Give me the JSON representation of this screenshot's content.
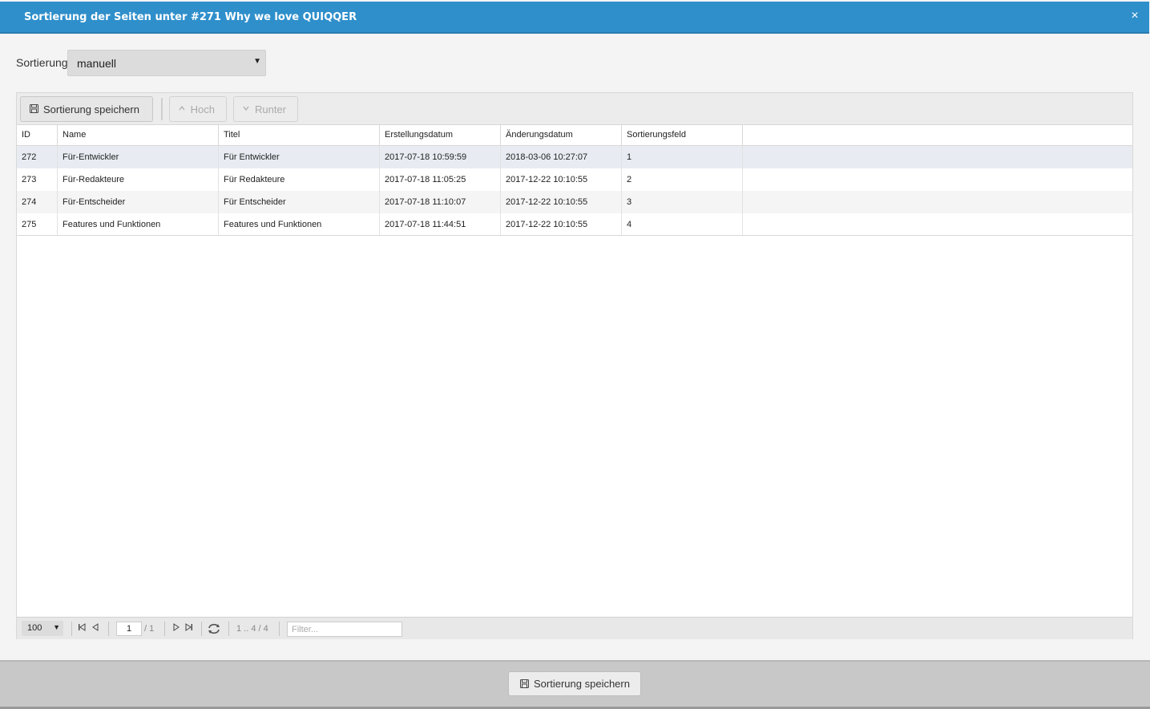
{
  "window": {
    "title": "Sortierung der Seiten unter #271 Why we love QUIQQER",
    "close_symbol": "×"
  },
  "sort": {
    "label": "Sortierung",
    "value": "manuell"
  },
  "toolbar": {
    "save_label": "Sortierung speichern",
    "up_label": "Hoch",
    "down_label": "Runter"
  },
  "table": {
    "columns": [
      "ID",
      "Name",
      "Titel",
      "Erstellungsdatum",
      "Änderungsdatum",
      "Sortierungsfeld"
    ],
    "rows": [
      [
        "272",
        "Für-Entwickler",
        "Für Entwickler",
        "2017-07-18 10:59:59",
        "2018-03-06 10:27:07",
        "1"
      ],
      [
        "273",
        "Für-Redakteure",
        "Für Redakteure",
        "2017-07-18 11:05:25",
        "2017-12-22 10:10:55",
        "2"
      ],
      [
        "274",
        "Für-Entscheider",
        "Für Entscheider",
        "2017-07-18 11:10:07",
        "2017-12-22 10:10:55",
        "3"
      ],
      [
        "275",
        "Features und Funktionen",
        "Features und Funktionen",
        "2017-07-18 11:44:51",
        "2017-12-22 10:10:55",
        "4"
      ]
    ]
  },
  "pager": {
    "per_page": "100",
    "page": "1",
    "page_total": "/ 1",
    "range": "1 .. 4 / 4",
    "filter_placeholder": "Filter..."
  },
  "footer": {
    "save_label": "Sortierung speichern"
  }
}
